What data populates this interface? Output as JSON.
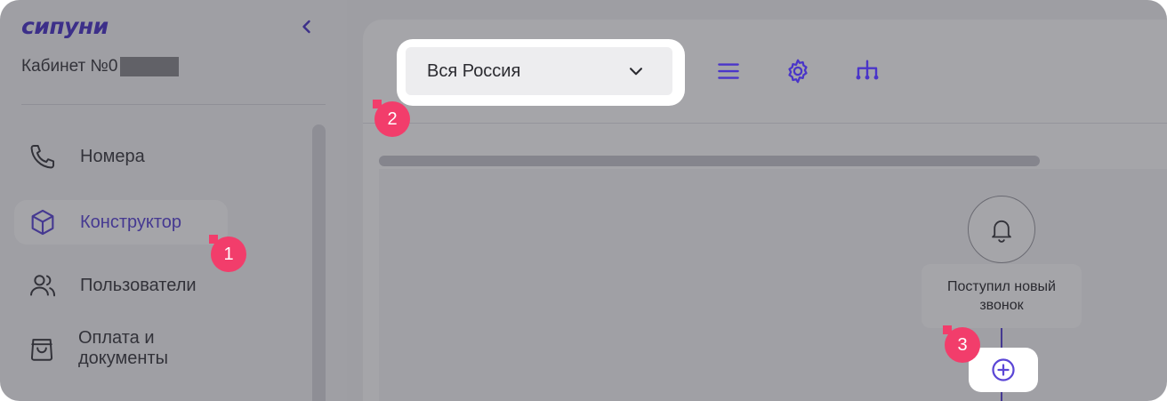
{
  "sidebar": {
    "logo_text": "сипуни",
    "cabinet_label": "Кабинет №0",
    "items": [
      {
        "label": "Номера",
        "icon": "phone-icon"
      },
      {
        "label": "Конструктор",
        "icon": "cube-icon",
        "active": true
      },
      {
        "label": "Пользователи",
        "icon": "users-icon"
      },
      {
        "label": "Оплата и документы",
        "icon": "shopping-bag-icon"
      }
    ]
  },
  "toolbar": {
    "region_value": "Вся Россия",
    "icons": [
      "menu-icon",
      "gear-icon",
      "hierarchy-icon"
    ]
  },
  "flow": {
    "event_label": "Поступил новый звонок"
  },
  "markers": [
    "1",
    "2",
    "3"
  ],
  "colors": {
    "accent": "#5b46d6",
    "marker": "#f23d6b",
    "logo": "#4a35c9"
  }
}
